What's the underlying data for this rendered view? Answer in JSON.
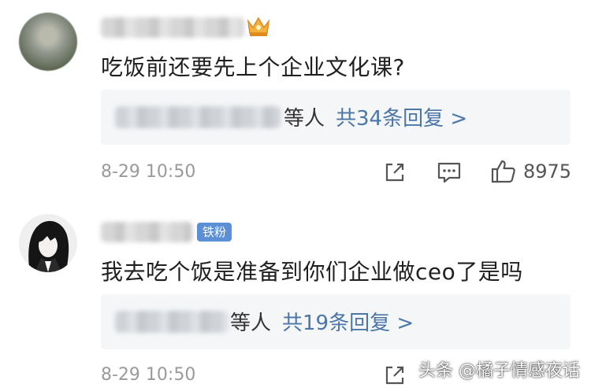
{
  "comments": [
    {
      "text": "吃饭前还要先上个企业文化课?",
      "reply_tail": "等人",
      "reply_count": "共34条回复 >",
      "time": "8-29 10:50",
      "likes": "8975"
    },
    {
      "badge": "铁粉",
      "text": "我去吃个饭是准备到你们企业做ceo了是吗",
      "reply_tail": "等人",
      "reply_count": "共19条回复 >",
      "time": "8-29 10:50"
    }
  ],
  "watermark": "头条 @橘子情感夜话",
  "colors": {
    "link": "#4a76a8",
    "badge": "#5b8fd6",
    "reply_bg": "#f5f6f8"
  }
}
